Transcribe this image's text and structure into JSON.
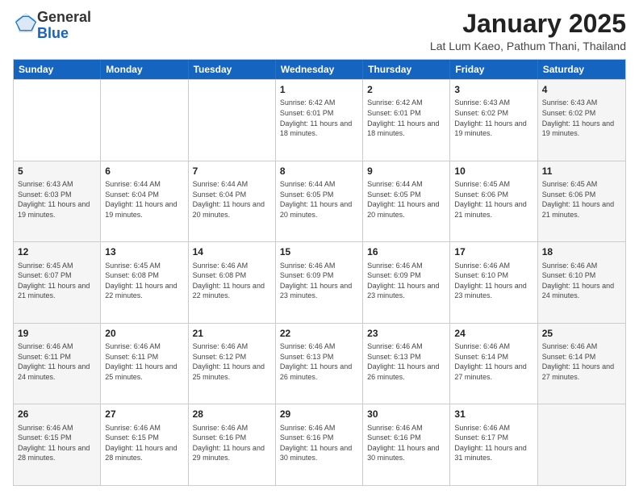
{
  "logo": {
    "general": "General",
    "blue": "Blue"
  },
  "title": "January 2025",
  "subtitle": "Lat Lum Kaeo, Pathum Thani, Thailand",
  "header_days": [
    "Sunday",
    "Monday",
    "Tuesday",
    "Wednesday",
    "Thursday",
    "Friday",
    "Saturday"
  ],
  "weeks": [
    [
      {
        "day": "",
        "info": "",
        "shaded": false
      },
      {
        "day": "",
        "info": "",
        "shaded": false
      },
      {
        "day": "",
        "info": "",
        "shaded": false
      },
      {
        "day": "1",
        "info": "Sunrise: 6:42 AM\nSunset: 6:01 PM\nDaylight: 11 hours and 18 minutes.",
        "shaded": false
      },
      {
        "day": "2",
        "info": "Sunrise: 6:42 AM\nSunset: 6:01 PM\nDaylight: 11 hours and 18 minutes.",
        "shaded": false
      },
      {
        "day": "3",
        "info": "Sunrise: 6:43 AM\nSunset: 6:02 PM\nDaylight: 11 hours and 19 minutes.",
        "shaded": false
      },
      {
        "day": "4",
        "info": "Sunrise: 6:43 AM\nSunset: 6:02 PM\nDaylight: 11 hours and 19 minutes.",
        "shaded": true
      }
    ],
    [
      {
        "day": "5",
        "info": "Sunrise: 6:43 AM\nSunset: 6:03 PM\nDaylight: 11 hours and 19 minutes.",
        "shaded": true
      },
      {
        "day": "6",
        "info": "Sunrise: 6:44 AM\nSunset: 6:04 PM\nDaylight: 11 hours and 19 minutes.",
        "shaded": false
      },
      {
        "day": "7",
        "info": "Sunrise: 6:44 AM\nSunset: 6:04 PM\nDaylight: 11 hours and 20 minutes.",
        "shaded": false
      },
      {
        "day": "8",
        "info": "Sunrise: 6:44 AM\nSunset: 6:05 PM\nDaylight: 11 hours and 20 minutes.",
        "shaded": false
      },
      {
        "day": "9",
        "info": "Sunrise: 6:44 AM\nSunset: 6:05 PM\nDaylight: 11 hours and 20 minutes.",
        "shaded": false
      },
      {
        "day": "10",
        "info": "Sunrise: 6:45 AM\nSunset: 6:06 PM\nDaylight: 11 hours and 21 minutes.",
        "shaded": false
      },
      {
        "day": "11",
        "info": "Sunrise: 6:45 AM\nSunset: 6:06 PM\nDaylight: 11 hours and 21 minutes.",
        "shaded": true
      }
    ],
    [
      {
        "day": "12",
        "info": "Sunrise: 6:45 AM\nSunset: 6:07 PM\nDaylight: 11 hours and 21 minutes.",
        "shaded": true
      },
      {
        "day": "13",
        "info": "Sunrise: 6:45 AM\nSunset: 6:08 PM\nDaylight: 11 hours and 22 minutes.",
        "shaded": false
      },
      {
        "day": "14",
        "info": "Sunrise: 6:46 AM\nSunset: 6:08 PM\nDaylight: 11 hours and 22 minutes.",
        "shaded": false
      },
      {
        "day": "15",
        "info": "Sunrise: 6:46 AM\nSunset: 6:09 PM\nDaylight: 11 hours and 23 minutes.",
        "shaded": false
      },
      {
        "day": "16",
        "info": "Sunrise: 6:46 AM\nSunset: 6:09 PM\nDaylight: 11 hours and 23 minutes.",
        "shaded": false
      },
      {
        "day": "17",
        "info": "Sunrise: 6:46 AM\nSunset: 6:10 PM\nDaylight: 11 hours and 23 minutes.",
        "shaded": false
      },
      {
        "day": "18",
        "info": "Sunrise: 6:46 AM\nSunset: 6:10 PM\nDaylight: 11 hours and 24 minutes.",
        "shaded": true
      }
    ],
    [
      {
        "day": "19",
        "info": "Sunrise: 6:46 AM\nSunset: 6:11 PM\nDaylight: 11 hours and 24 minutes.",
        "shaded": true
      },
      {
        "day": "20",
        "info": "Sunrise: 6:46 AM\nSunset: 6:11 PM\nDaylight: 11 hours and 25 minutes.",
        "shaded": false
      },
      {
        "day": "21",
        "info": "Sunrise: 6:46 AM\nSunset: 6:12 PM\nDaylight: 11 hours and 25 minutes.",
        "shaded": false
      },
      {
        "day": "22",
        "info": "Sunrise: 6:46 AM\nSunset: 6:13 PM\nDaylight: 11 hours and 26 minutes.",
        "shaded": false
      },
      {
        "day": "23",
        "info": "Sunrise: 6:46 AM\nSunset: 6:13 PM\nDaylight: 11 hours and 26 minutes.",
        "shaded": false
      },
      {
        "day": "24",
        "info": "Sunrise: 6:46 AM\nSunset: 6:14 PM\nDaylight: 11 hours and 27 minutes.",
        "shaded": false
      },
      {
        "day": "25",
        "info": "Sunrise: 6:46 AM\nSunset: 6:14 PM\nDaylight: 11 hours and 27 minutes.",
        "shaded": true
      }
    ],
    [
      {
        "day": "26",
        "info": "Sunrise: 6:46 AM\nSunset: 6:15 PM\nDaylight: 11 hours and 28 minutes.",
        "shaded": true
      },
      {
        "day": "27",
        "info": "Sunrise: 6:46 AM\nSunset: 6:15 PM\nDaylight: 11 hours and 28 minutes.",
        "shaded": false
      },
      {
        "day": "28",
        "info": "Sunrise: 6:46 AM\nSunset: 6:16 PM\nDaylight: 11 hours and 29 minutes.",
        "shaded": false
      },
      {
        "day": "29",
        "info": "Sunrise: 6:46 AM\nSunset: 6:16 PM\nDaylight: 11 hours and 30 minutes.",
        "shaded": false
      },
      {
        "day": "30",
        "info": "Sunrise: 6:46 AM\nSunset: 6:16 PM\nDaylight: 11 hours and 30 minutes.",
        "shaded": false
      },
      {
        "day": "31",
        "info": "Sunrise: 6:46 AM\nSunset: 6:17 PM\nDaylight: 11 hours and 31 minutes.",
        "shaded": false
      },
      {
        "day": "",
        "info": "",
        "shaded": true
      }
    ]
  ]
}
